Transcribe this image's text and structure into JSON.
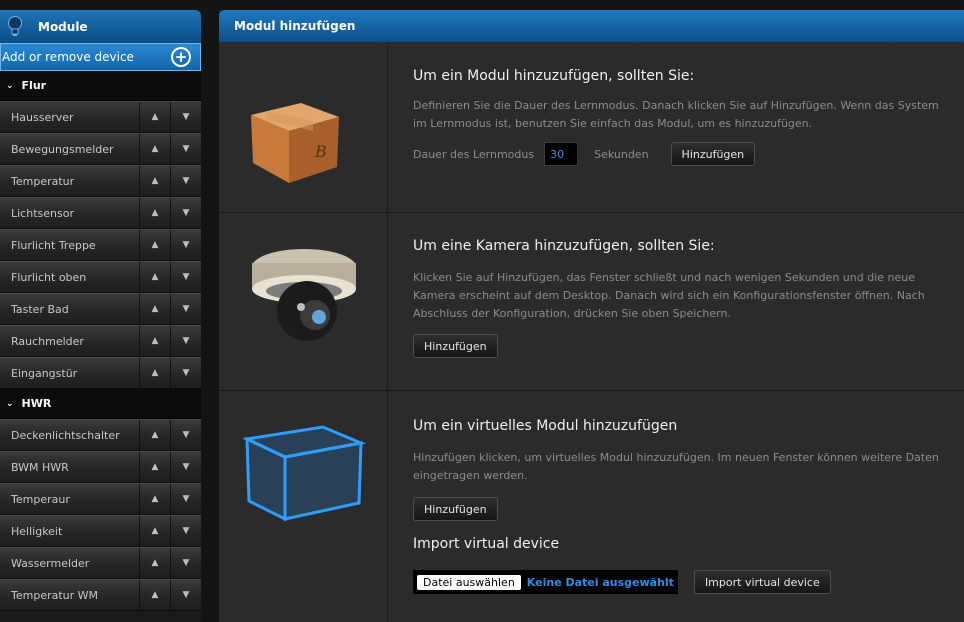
{
  "sidebar": {
    "title": "Module",
    "add_label": "Add or remove device",
    "groups": [
      {
        "name": "Flur",
        "items": [
          "Hausserver",
          "Bewegungsmelder",
          "Temperatur",
          "Lichtsensor",
          "Flurlicht Treppe",
          "Flurlicht oben",
          "Taster Bad",
          "Rauchmelder",
          "Eingangstür"
        ]
      },
      {
        "name": "HWR",
        "items": [
          "Deckenlichtschalter",
          "BWM HWR",
          "Temperaur",
          "Helligkeit",
          "Wassermelder",
          "Temperatur WM"
        ]
      }
    ]
  },
  "main": {
    "title": "Modul hinzufügen",
    "module": {
      "heading": "Um ein Modul hinzuzufügen, sollten Sie:",
      "description": "Definieren Sie die Dauer des Lernmodus. Danach klicken Sie auf Hinzufügen. Wenn das System im Lernmodus ist, benutzen Sie einfach das Modul, um es hinzuzufügen.",
      "duration_label": "Dauer des Lernmodus",
      "duration_value": "30",
      "unit_label": "Sekunden",
      "add_button": "Hinzufügen"
    },
    "camera": {
      "heading": "Um eine Kamera hinzuzufügen, sollten Sie:",
      "description": "Klicken Sie auf Hinzufügen, das Fenster schließt und nach wenigen Sekunden und die neue Kamera erscheint auf dem Desktop. Danach wird sich ein Konfigurationsfenster öffnen. Nach Abschluss der Konfiguration, drücken Sie oben Speichern.",
      "add_button": "Hinzufügen"
    },
    "virtual": {
      "heading": "Um ein virtuelles Modul hinzuzufügen",
      "description": "Hinzufügen klicken, um virtuelles Modul hinzuzufügen. Im neuen Fenster können weitere Daten eingetragen werden.",
      "add_button": "Hinzufügen",
      "import_heading": "Import virtual device",
      "file_button": "Datei auswählen",
      "file_status": "Keine Datei ausgewählt",
      "import_button": "Import virtual device"
    }
  },
  "icons": {
    "sidebar": "lightbulb-icon",
    "add": "plus-circle-icon",
    "group": "chevron-down-icon",
    "move_up": "arrow-up-icon",
    "move_down": "arrow-down-icon",
    "module": "box-icon",
    "camera": "camera-icon",
    "virtual": "virtual-cube-icon"
  },
  "colors": {
    "accent": "#1a6eb0",
    "link": "#2f8de0"
  }
}
